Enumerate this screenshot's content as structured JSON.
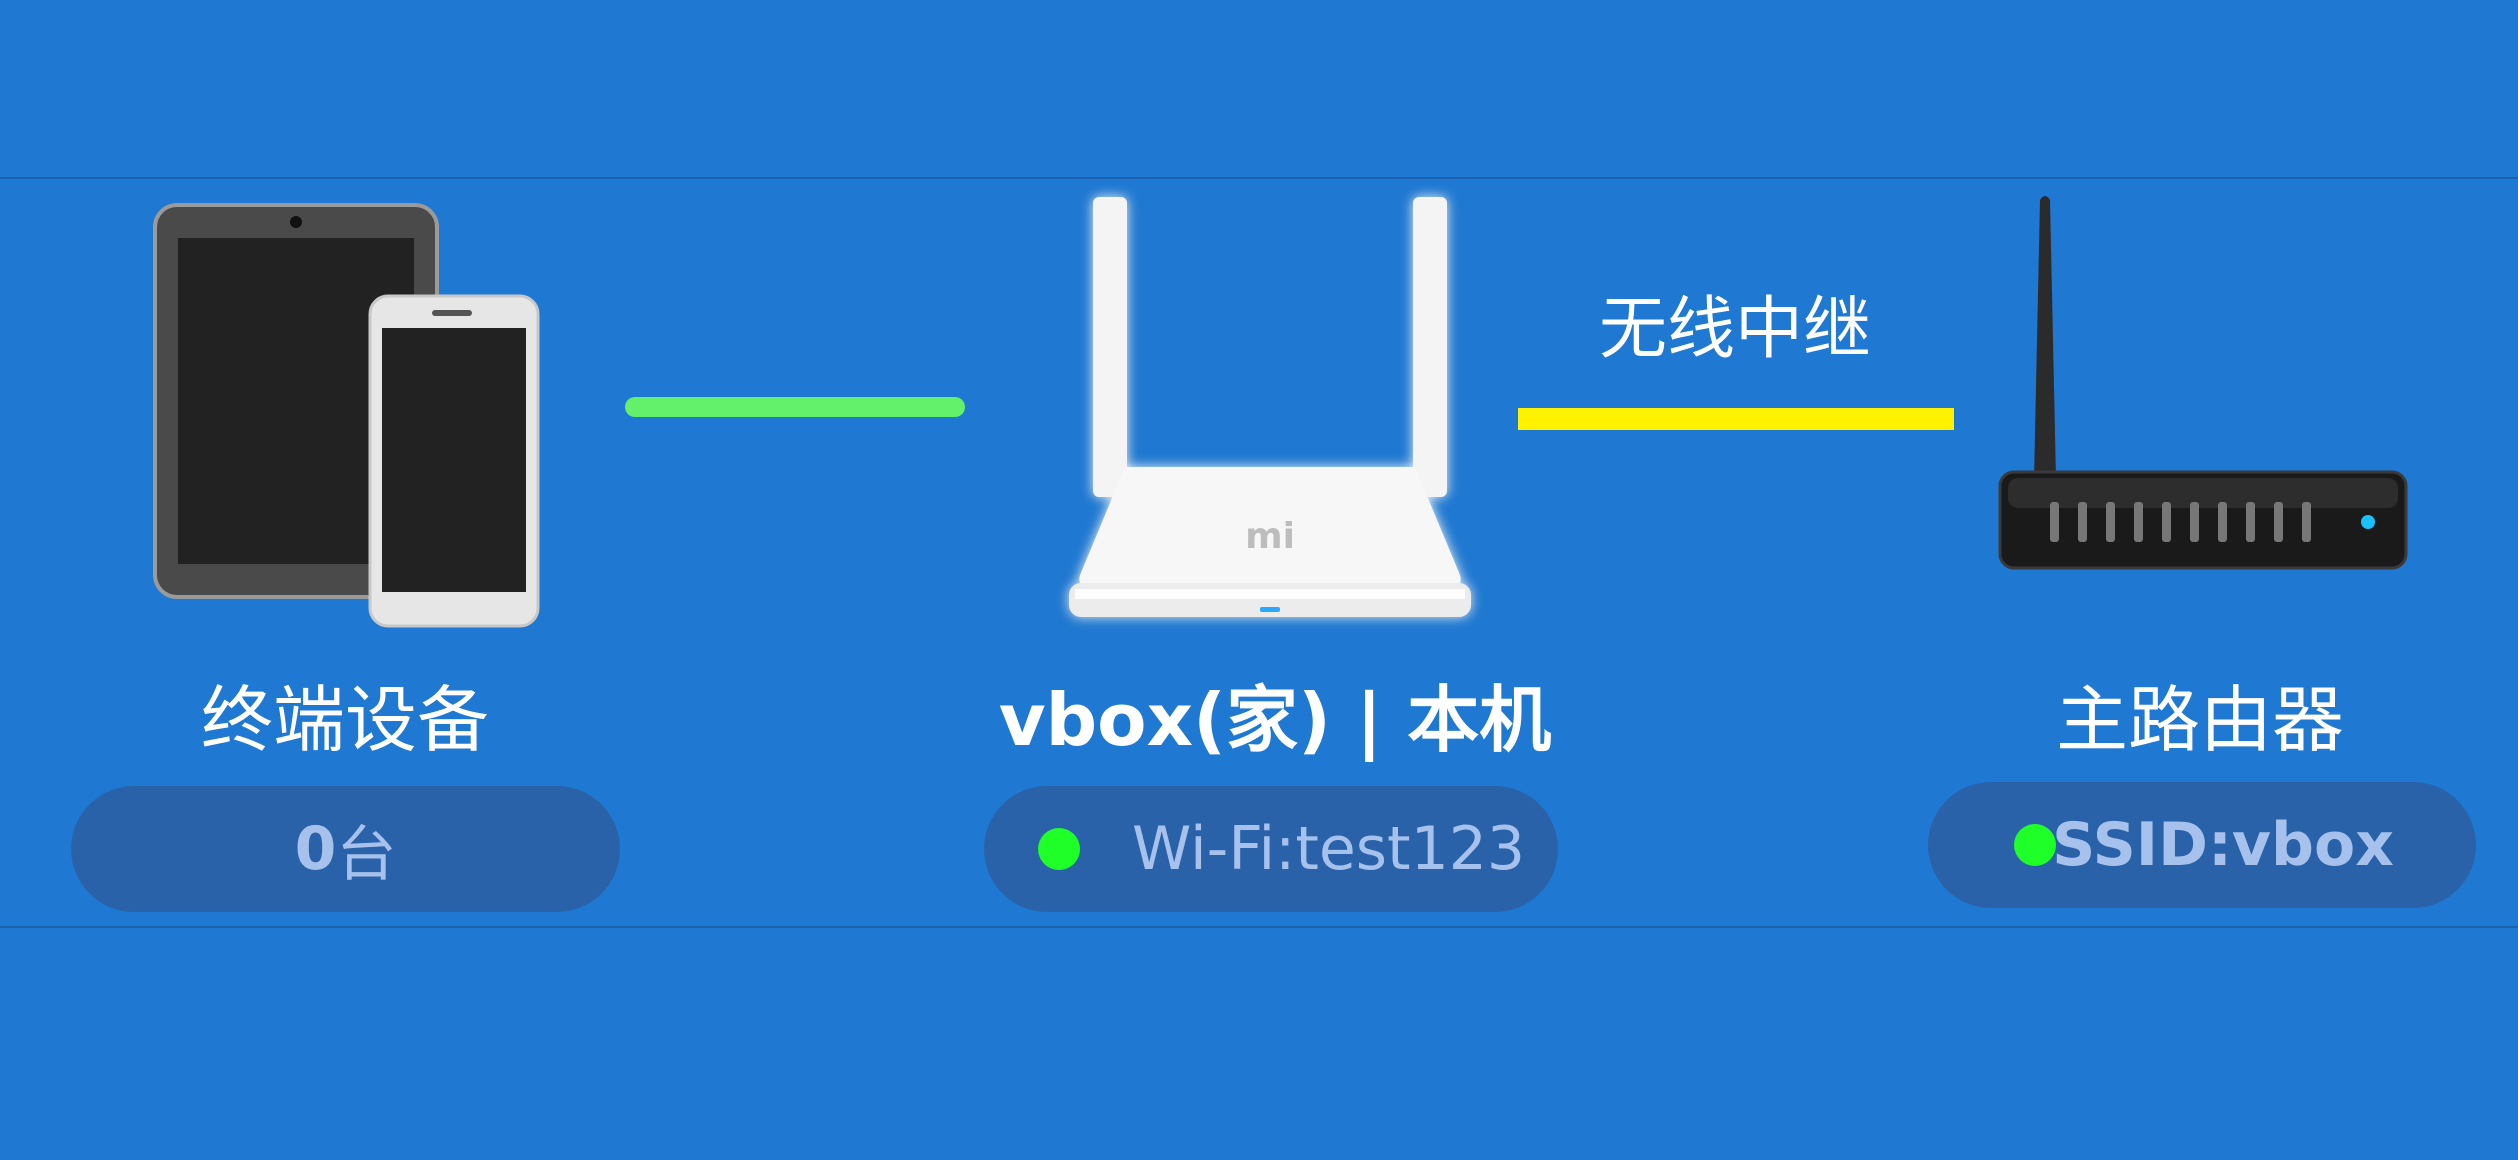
{
  "terminal": {
    "label": "终端设备",
    "count_number": "0",
    "count_unit": "台",
    "icon": "tablet-phone-icon"
  },
  "local_router": {
    "label": "vbox(家) | 本机",
    "wifi_text": "Wi-Fi:test123",
    "status_color": "#1fff28",
    "icon": "mi-router-icon"
  },
  "link": {
    "relay_label": "无线中继",
    "terminal_link_color": "#63f06a",
    "relay_link_color": "#fff200"
  },
  "main_router": {
    "label": "主路由器",
    "ssid_text": "SSID:vbox",
    "status_color": "#1fff28",
    "icon": "router-antenna-icon"
  },
  "colors": {
    "background": "#1f78d1",
    "pill": "#2a62a9",
    "pill_text": "#a6c2ec"
  }
}
